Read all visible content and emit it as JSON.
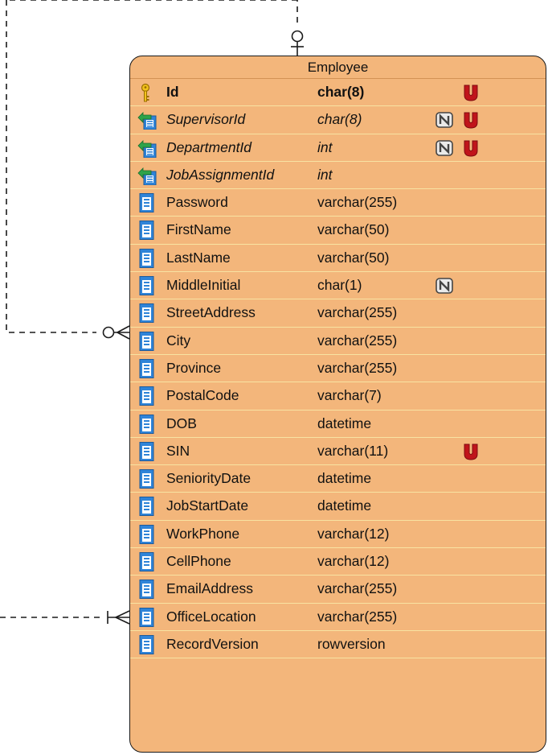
{
  "entity": {
    "name": "Employee",
    "columns": [
      {
        "name": "Id",
        "type": "char(8)",
        "kind": "pk",
        "nullable": false,
        "unique": true
      },
      {
        "name": "SupervisorId",
        "type": "char(8)",
        "kind": "fk",
        "nullable": true,
        "unique": true
      },
      {
        "name": "DepartmentId",
        "type": "int",
        "kind": "fk",
        "nullable": true,
        "unique": true
      },
      {
        "name": "JobAssignmentId",
        "type": "int",
        "kind": "fk",
        "nullable": false,
        "unique": false
      },
      {
        "name": "Password",
        "type": "varchar(255)",
        "kind": "col",
        "nullable": false,
        "unique": false
      },
      {
        "name": "FirstName",
        "type": "varchar(50)",
        "kind": "col",
        "nullable": false,
        "unique": false
      },
      {
        "name": "LastName",
        "type": "varchar(50)",
        "kind": "col",
        "nullable": false,
        "unique": false
      },
      {
        "name": "MiddleInitial",
        "type": "char(1)",
        "kind": "col",
        "nullable": true,
        "unique": false
      },
      {
        "name": "StreetAddress",
        "type": "varchar(255)",
        "kind": "col",
        "nullable": false,
        "unique": false
      },
      {
        "name": "City",
        "type": "varchar(255)",
        "kind": "col",
        "nullable": false,
        "unique": false
      },
      {
        "name": "Province",
        "type": "varchar(255)",
        "kind": "col",
        "nullable": false,
        "unique": false
      },
      {
        "name": "PostalCode",
        "type": "varchar(7)",
        "kind": "col",
        "nullable": false,
        "unique": false
      },
      {
        "name": "DOB",
        "type": "datetime",
        "kind": "col",
        "nullable": false,
        "unique": false
      },
      {
        "name": "SIN",
        "type": "varchar(11)",
        "kind": "col",
        "nullable": false,
        "unique": true
      },
      {
        "name": "SeniorityDate",
        "type": "datetime",
        "kind": "col",
        "nullable": false,
        "unique": false
      },
      {
        "name": "JobStartDate",
        "type": "datetime",
        "kind": "col",
        "nullable": false,
        "unique": false
      },
      {
        "name": "WorkPhone",
        "type": "varchar(12)",
        "kind": "col",
        "nullable": false,
        "unique": false
      },
      {
        "name": "CellPhone",
        "type": "varchar(12)",
        "kind": "col",
        "nullable": false,
        "unique": false
      },
      {
        "name": "EmailAddress",
        "type": "varchar(255)",
        "kind": "col",
        "nullable": false,
        "unique": false
      },
      {
        "name": "OfficeLocation",
        "type": "varchar(255)",
        "kind": "col",
        "nullable": false,
        "unique": false
      },
      {
        "name": "RecordVersion",
        "type": "rowversion",
        "kind": "col",
        "nullable": false,
        "unique": false
      }
    ]
  },
  "relationships": [
    {
      "id": "self-reference",
      "from": "Employee",
      "to": "Employee",
      "end_top": "zero-or-one",
      "end_left": "zero-or-many"
    },
    {
      "id": "office-location",
      "to": "Employee",
      "end": "one-or-many"
    }
  ],
  "colors": {
    "entity_fill": "#f3b67b",
    "row_divider": "#f8e3a2",
    "unique_flag": "#c0141b",
    "nullable_flag": "#555555",
    "line": "#1a1a1a"
  },
  "icons": {
    "pk": "key-icon",
    "fk": "foreign-key-column-icon",
    "col": "column-icon",
    "nullable": "nullable-n-icon",
    "unique": "unique-u-icon"
  }
}
